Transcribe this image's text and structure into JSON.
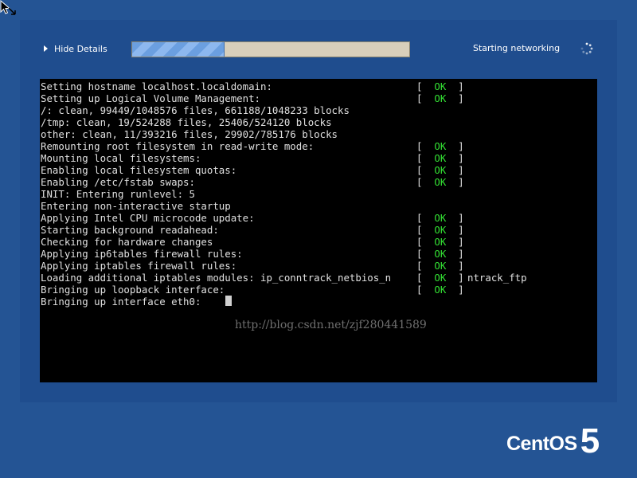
{
  "header": {
    "toggle_label": "Hide Details",
    "progress_fraction": 0.33,
    "status_text": "Starting networking"
  },
  "console": {
    "lines": [
      {
        "text": "Setting hostname localhost.localdomain:",
        "status": "OK"
      },
      {
        "text": "Setting up Logical Volume Management:",
        "status": "OK"
      },
      {
        "text": "/: clean, 99449/1048576 files, 661188/1048233 blocks"
      },
      {
        "text": "/tmp: clean, 19/524288 files, 25406/524120 blocks"
      },
      {
        "text": "other: clean, 11/393216 files, 29902/785176 blocks"
      },
      {
        "text": "Remounting root filesystem in read-write mode:",
        "status": "OK"
      },
      {
        "text": "Mounting local filesystems:",
        "status": "OK"
      },
      {
        "text": "Enabling local filesystem quotas:",
        "status": "OK"
      },
      {
        "text": "Enabling /etc/fstab swaps:",
        "status": "OK"
      },
      {
        "text": "INIT: Entering runlevel: 5"
      },
      {
        "text": "Entering non-interactive startup"
      },
      {
        "text": "Applying Intel CPU microcode update:",
        "status": "OK"
      },
      {
        "text": "Starting background readahead:",
        "status": "OK"
      },
      {
        "text": "Checking for hardware changes",
        "status": "OK"
      },
      {
        "text": "Applying ip6tables firewall rules:",
        "status": "OK"
      },
      {
        "text": "Applying iptables firewall rules:",
        "status": "OK"
      },
      {
        "text": "Loading additional iptables modules: ip_conntrack_netbios_n",
        "status": "OK",
        "tail": "ntrack_ftp"
      },
      {
        "text": "Bringing up loopback interface:",
        "status": "OK"
      },
      {
        "text": "Bringing up interface eth0:"
      }
    ],
    "watermark": "http://blog.csdn.net/zjf280441589"
  },
  "branding": {
    "logo_text": "CentOS",
    "logo_version": "5"
  },
  "colors": {
    "background": "#245494",
    "panel": "#1f4d8e",
    "ok_green": "#33e033"
  },
  "icons": {
    "toggle": "triangle-right-icon",
    "spinner": "spinner-icon",
    "mouse": "mouse-cursor-icon"
  }
}
